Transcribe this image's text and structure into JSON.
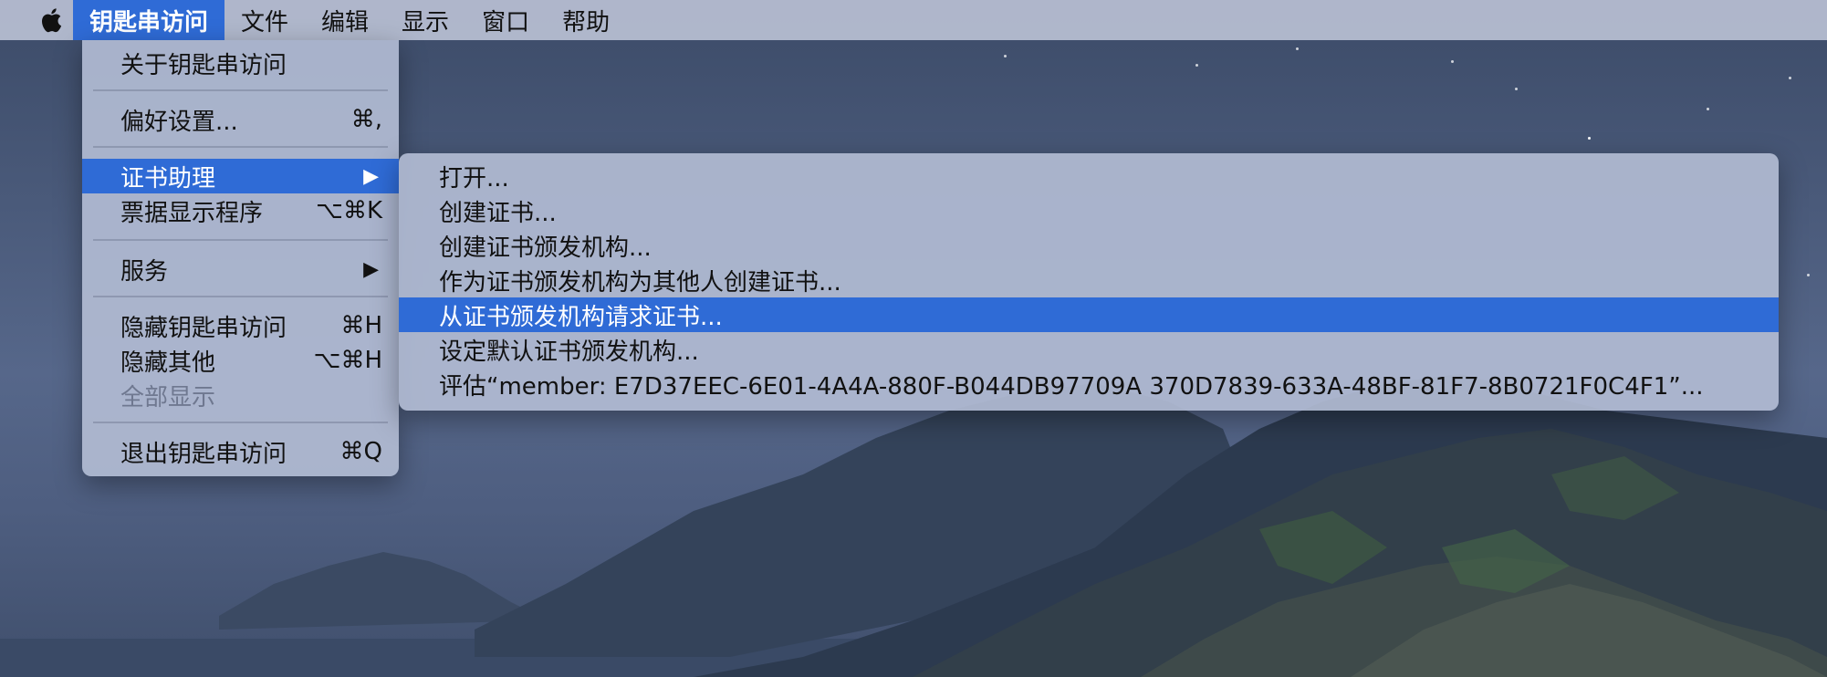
{
  "menubar": {
    "apple_icon": "apple-icon",
    "items": [
      {
        "label": "钥匙串访问",
        "active": true
      },
      {
        "label": "文件"
      },
      {
        "label": "编辑"
      },
      {
        "label": "显示"
      },
      {
        "label": "窗口"
      },
      {
        "label": "帮助"
      }
    ]
  },
  "app_menu": {
    "items": [
      {
        "label": "关于钥匙串访问",
        "shortcut": ""
      },
      {
        "label": "偏好设置...",
        "shortcut": "⌘,"
      },
      {
        "label": "证书助理",
        "submenu_arrow": "▶",
        "highlighted": true
      },
      {
        "label": "票据显示程序",
        "shortcut": "⌥⌘K"
      },
      {
        "label": "服务",
        "submenu_arrow": "▶"
      },
      {
        "label": "隐藏钥匙串访问",
        "shortcut": "⌘H"
      },
      {
        "label": "隐藏其他",
        "shortcut": "⌥⌘H"
      },
      {
        "label": "全部显示",
        "disabled": true
      },
      {
        "label": "退出钥匙串访问",
        "shortcut": "⌘Q"
      }
    ]
  },
  "cert_submenu": {
    "items": [
      {
        "label": "打开..."
      },
      {
        "label": "创建证书..."
      },
      {
        "label": "创建证书颁发机构..."
      },
      {
        "label": "作为证书颁发机构为其他人创建证书..."
      },
      {
        "label": "从证书颁发机构请求证书...",
        "highlighted": true
      },
      {
        "label": "设定默认证书颁发机构..."
      },
      {
        "label": "评估“member: E7D37EEC-6E01-4A4A-880F-B044DB97709A 370D7839-633A-48BF-81F7-8B0721F0C4F1”..."
      }
    ]
  },
  "colors": {
    "highlight": "#2f6bd6",
    "menubar": "#c8cee0",
    "menu_bg": "#b0bad2"
  }
}
